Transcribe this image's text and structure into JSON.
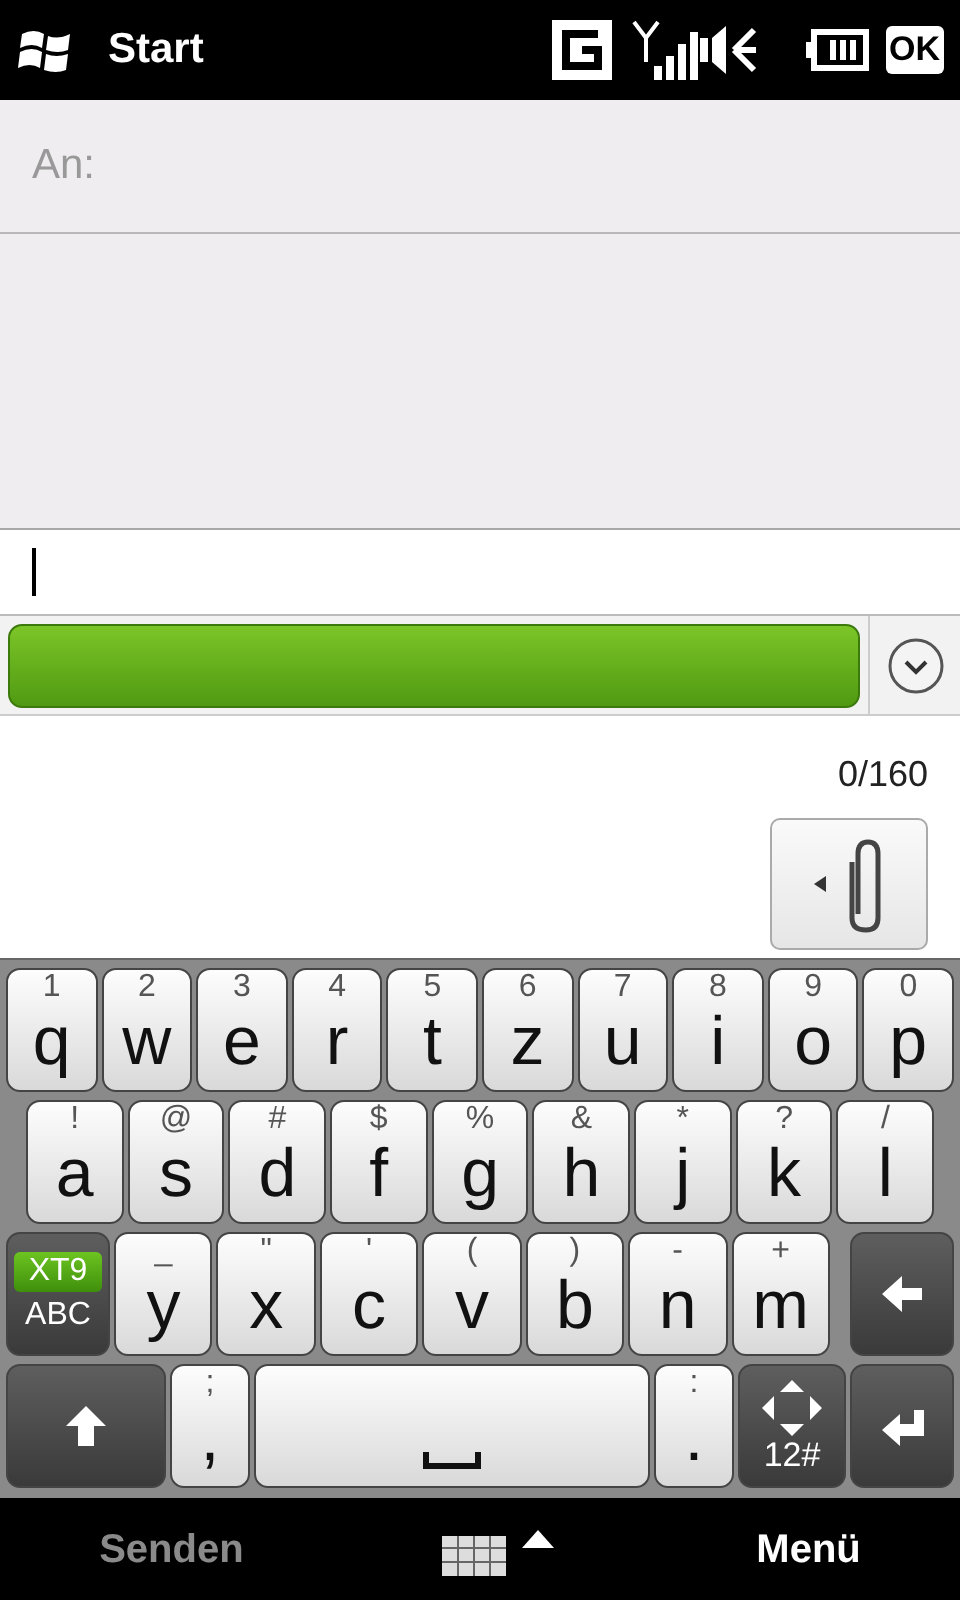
{
  "title_bar": {
    "title": "Start",
    "ok_button": "OK"
  },
  "message": {
    "to_label": "An:",
    "counter": "0/160"
  },
  "keyboard": {
    "rows": [
      {
        "keys": [
          {
            "kind": "letter",
            "alt": "1",
            "main": "q"
          },
          {
            "kind": "letter",
            "alt": "2",
            "main": "w"
          },
          {
            "kind": "letter",
            "alt": "3",
            "main": "e"
          },
          {
            "kind": "letter",
            "alt": "4",
            "main": "r"
          },
          {
            "kind": "letter",
            "alt": "5",
            "main": "t"
          },
          {
            "kind": "letter",
            "alt": "6",
            "main": "z"
          },
          {
            "kind": "letter",
            "alt": "7",
            "main": "u"
          },
          {
            "kind": "letter",
            "alt": "8",
            "main": "i"
          },
          {
            "kind": "letter",
            "alt": "9",
            "main": "o"
          },
          {
            "kind": "letter",
            "alt": "0",
            "main": "p"
          }
        ]
      },
      {
        "keys": [
          {
            "kind": "letter",
            "alt": "!",
            "main": "a"
          },
          {
            "kind": "letter",
            "alt": "@",
            "main": "s"
          },
          {
            "kind": "letter",
            "alt": "#",
            "main": "d"
          },
          {
            "kind": "letter",
            "alt": "$",
            "main": "f"
          },
          {
            "kind": "letter",
            "alt": "%",
            "main": "g"
          },
          {
            "kind": "letter",
            "alt": "&",
            "main": "h"
          },
          {
            "kind": "letter",
            "alt": "*",
            "main": "j"
          },
          {
            "kind": "letter",
            "alt": "?",
            "main": "k"
          },
          {
            "kind": "letter",
            "alt": "/",
            "main": "l"
          }
        ]
      },
      {
        "keys": [
          {
            "kind": "mode",
            "modes": [
              {
                "label": "XT9",
                "selected": true
              },
              {
                "label": "ABC",
                "selected": false
              }
            ]
          },
          {
            "kind": "letter",
            "alt": "_",
            "main": "y"
          },
          {
            "kind": "letter",
            "alt": "\"",
            "main": "x"
          },
          {
            "kind": "letter",
            "alt": "'",
            "main": "c"
          },
          {
            "kind": "letter",
            "alt": "(",
            "main": "v"
          },
          {
            "kind": "letter",
            "alt": ")",
            "main": "b"
          },
          {
            "kind": "letter",
            "alt": "-",
            "main": "n"
          },
          {
            "kind": "letter",
            "alt": "+",
            "main": "m"
          },
          {
            "kind": "backspace"
          }
        ]
      },
      {
        "keys": [
          {
            "kind": "shift"
          },
          {
            "kind": "letter",
            "alt": ";",
            "main": ","
          },
          {
            "kind": "space"
          },
          {
            "kind": "letter",
            "alt": ":",
            "main": "."
          },
          {
            "kind": "nav",
            "main": "12#"
          },
          {
            "kind": "enter"
          }
        ]
      }
    ]
  },
  "softkeys": [
    {
      "label": "Senden",
      "disabled": true
    },
    {
      "label": "Menü",
      "disabled": false
    }
  ]
}
